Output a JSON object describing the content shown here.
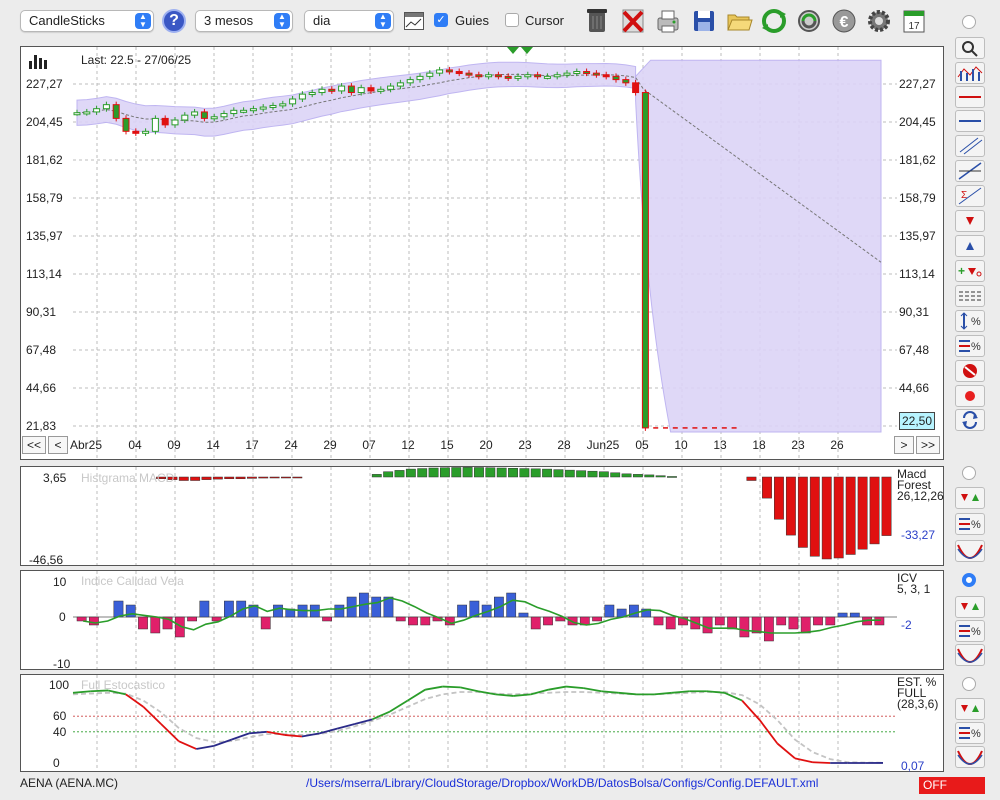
{
  "toolbar": {
    "chart_type": "CandleSticks",
    "period": "3 mesos",
    "interval": "dia",
    "guies_label": "Guies",
    "guies_checked": true,
    "cursor_label": "Cursor",
    "cursor_checked": false,
    "help_label": "?"
  },
  "main_chart": {
    "last_text": "Last: 22.5 - 27/06/25",
    "y_ticks": [
      "227,27",
      "204,45",
      "181,62",
      "158,79",
      "135,97",
      "113,14",
      "90,31",
      "67,48",
      "44,66",
      "21,83"
    ],
    "last_badge": "22,50",
    "x_labels": [
      "Abr25",
      "04",
      "09",
      "14",
      "17",
      "24",
      "29",
      "07",
      "12",
      "15",
      "20",
      "23",
      "28",
      "Jun25",
      "05",
      "10",
      "13",
      "18",
      "23",
      "26"
    ],
    "nav": {
      "first": "<<",
      "prev": "<",
      "next": ">",
      "last": ">>"
    }
  },
  "macd": {
    "title": "Histgrama MACD",
    "y_max": "3,65",
    "y_min": "-46,56",
    "legend_name": "Macd",
    "legend_sub": "Forest",
    "legend_params": "26,12,26",
    "value": "-33,27"
  },
  "icv": {
    "title": "Indice Calidad Vela",
    "y_max": "10",
    "y_zero": "0",
    "y_min": "-10",
    "legend_name": "ICV",
    "legend_params": "5, 3, 1",
    "value": "-2"
  },
  "stoch": {
    "title": "Full Estocastico",
    "y_ticks": [
      "100",
      "60",
      "40",
      "0"
    ],
    "legend_name": "EST. %",
    "legend_sub": "FULL",
    "legend_params": "(28,3,6)",
    "value": "0,07"
  },
  "status": {
    "symbol": "AENA (AENA.MC)",
    "path": "/Users/mserra/Library/CloudStorage/Dropbox/WorkDB/DatosBolsa/Configs/Config.DEFAULT.xml",
    "off_label": "OFF"
  },
  "colors": {
    "up": "#2a9d2a",
    "down": "#e01010",
    "band": "#d9d2f5",
    "macd_neg": "#e01010",
    "macd_pos": "#2a9d2a",
    "icv_pos": "#3a5fd8",
    "icv_neg": "#e0206a"
  },
  "chart_data": {
    "type": "candlestick",
    "close": [
      217.5,
      218,
      220,
      222.5,
      214,
      206,
      205,
      206,
      214,
      210,
      213,
      216,
      218,
      214,
      215,
      217,
      219,
      219,
      220,
      221,
      222,
      223,
      226,
      229,
      230,
      232,
      231,
      234,
      230,
      233,
      231,
      232,
      234,
      236,
      238,
      240,
      242,
      244,
      243,
      242,
      241,
      240,
      241,
      240,
      239,
      240,
      241,
      240,
      240,
      241,
      242,
      243,
      242,
      241,
      240,
      238,
      236,
      230,
      22.5,
      22.5,
      22.5,
      22.5,
      22.5,
      22.5,
      22.5,
      22.5,
      22.5,
      22.5
    ],
    "ylim": [
      21.83,
      240
    ],
    "macd_hist": [
      0,
      0,
      0,
      0,
      -1,
      -1.5,
      -2,
      -2,
      -1.5,
      -1.2,
      -1,
      -1,
      -0.8,
      -0.6,
      -0.5,
      -0.3,
      -0.2,
      0,
      0,
      0,
      0,
      0,
      0,
      1,
      2,
      2.5,
      3,
      3.2,
      3.4,
      3.5,
      3.6,
      3.65,
      3.6,
      3.5,
      3.4,
      3.3,
      3.2,
      3.1,
      3,
      2.8,
      2.6,
      2.4,
      2.2,
      2,
      1.6,
      1.2,
      1,
      0.8,
      0.5,
      0.2,
      0,
      0,
      0,
      0,
      0,
      0,
      -2,
      -12,
      -24,
      -33,
      -40,
      -45,
      -46.56,
      -46,
      -44,
      -41,
      -38,
      -33.27
    ],
    "icv": [
      -1,
      -2,
      0,
      4,
      3,
      -3,
      -4,
      -3,
      -5,
      -1,
      4,
      -1,
      4,
      4,
      3,
      -3,
      3,
      2,
      3,
      3,
      -1,
      3,
      5,
      6,
      5,
      5,
      -1,
      -2,
      -2,
      -1,
      -2,
      3,
      4,
      3,
      5,
      6,
      1,
      -3,
      -2,
      -1,
      -2,
      -2,
      -1,
      3,
      2,
      3,
      2,
      -2,
      -3,
      -2,
      -3,
      -4,
      -2,
      -3,
      -5,
      -4,
      -6,
      -2,
      -3,
      -4,
      -2,
      -2,
      1,
      1,
      -2,
      -2
    ],
    "stoch_k": [
      90,
      92,
      93,
      88,
      72,
      50,
      28,
      18,
      22,
      30,
      38,
      40,
      36,
      34,
      38,
      44,
      50,
      56,
      66,
      80,
      94,
      98,
      97,
      92,
      88,
      86,
      88,
      94,
      98,
      96,
      92,
      90,
      88,
      88,
      90,
      92,
      92,
      90,
      80,
      55,
      25,
      6,
      1,
      0,
      0,
      0,
      0.07
    ],
    "stoch_d": [
      88,
      89,
      90,
      89,
      80,
      65,
      45,
      32,
      27,
      28,
      33,
      37,
      37,
      36,
      37,
      41,
      47,
      54,
      62,
      72,
      82,
      88,
      91,
      91,
      89,
      88,
      89,
      90,
      91,
      91,
      90,
      89,
      88,
      88,
      89,
      90,
      91,
      91,
      87,
      75,
      55,
      30,
      14,
      5,
      1,
      0.5,
      0.3
    ]
  }
}
